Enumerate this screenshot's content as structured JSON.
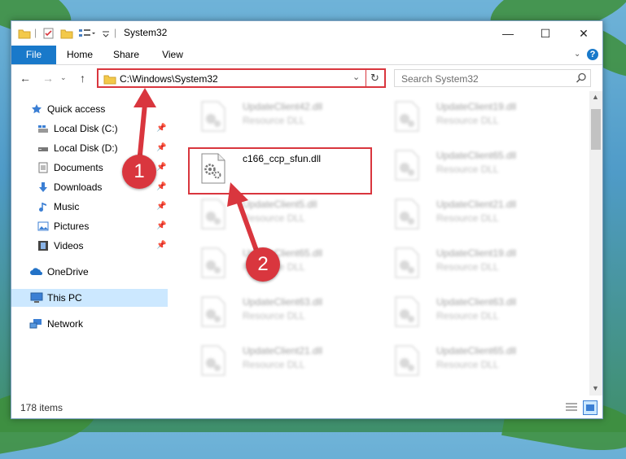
{
  "window": {
    "title": "System32",
    "controls": {
      "minimize": "—",
      "maximize": "☐",
      "close": "✕"
    }
  },
  "ribbon": {
    "tabs": [
      "File",
      "Home",
      "Share",
      "View"
    ],
    "help_icon": "?"
  },
  "address": {
    "path": "C:\\Windows\\System32",
    "search_placeholder": "Search System32"
  },
  "sidebar": {
    "items": [
      {
        "label": "Quick access",
        "icon": "star-icon",
        "pinned": false
      },
      {
        "label": "Local Disk (C:)",
        "icon": "drive-icon",
        "pinned": true
      },
      {
        "label": "Local Disk (D:)",
        "icon": "drive-icon",
        "pinned": true
      },
      {
        "label": "Documents",
        "icon": "document-icon",
        "pinned": true
      },
      {
        "label": "Downloads",
        "icon": "download-icon",
        "pinned": true
      },
      {
        "label": "Music",
        "icon": "music-icon",
        "pinned": true
      },
      {
        "label": "Pictures",
        "icon": "pictures-icon",
        "pinned": true
      },
      {
        "label": "Videos",
        "icon": "videos-icon",
        "pinned": true
      },
      {
        "label": "OneDrive",
        "icon": "cloud-icon",
        "pinned": false
      },
      {
        "label": "This PC",
        "icon": "computer-icon",
        "pinned": false,
        "selected": true
      },
      {
        "label": "Network",
        "icon": "network-icon",
        "pinned": false
      }
    ]
  },
  "files": {
    "left": [
      {
        "name": "UpdateClient42.dll",
        "type": "Resource DLL"
      },
      {
        "name": "c166_ccp_sfun.dll",
        "type": "",
        "highlight": true
      },
      {
        "name": "UpdateClient5.dll",
        "type": "Resource DLL"
      },
      {
        "name": "UpdateClient65.dll",
        "type": "Resource DLL"
      },
      {
        "name": "UpdateClient63.dll",
        "type": "Resource DLL"
      },
      {
        "name": "UpdateClient21.dll",
        "type": "Resource DLL"
      }
    ],
    "right": [
      {
        "name": "UpdateClient19.dll",
        "type": "Resource DLL"
      },
      {
        "name": "UpdateClient65.dll",
        "type": "Resource DLL"
      },
      {
        "name": "UpdateClient21.dll",
        "type": "Resource DLL"
      },
      {
        "name": "UpdateClient19.dll",
        "type": "Resource DLL"
      },
      {
        "name": "UpdateClient63.dll",
        "type": "Resource DLL"
      },
      {
        "name": "UpdateClient65.dll",
        "type": "Resource DLL"
      }
    ]
  },
  "status": {
    "items_count": "178 items"
  },
  "annotations": {
    "step1": "1",
    "step2": "2",
    "color": "#d9363e"
  },
  "colors": {
    "accent": "#1979ca",
    "selection": "#cce8ff",
    "highlight": "#d9363e"
  }
}
